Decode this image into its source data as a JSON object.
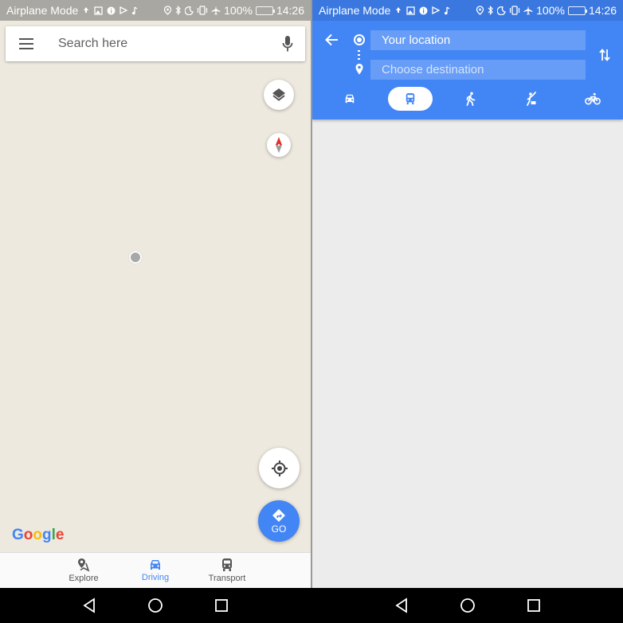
{
  "status_bar_left": {
    "mode_text": "Airplane Mode",
    "battery": "100%",
    "time": "14:26"
  },
  "status_bar_right": {
    "mode_text": "Airplane Mode",
    "battery": "100%",
    "time": "14:26"
  },
  "map": {
    "search_placeholder": "Search here",
    "go_label": "GO",
    "logo": "Google",
    "logo_colors": [
      "#4285f4",
      "#ea4335",
      "#fbbc05",
      "#4285f4",
      "#34a853",
      "#ea4335"
    ],
    "icons": [
      "menu-icon",
      "mic-icon",
      "layers-icon",
      "compass-icon",
      "my-location-icon",
      "directions-icon"
    ]
  },
  "bottom_nav": {
    "items": [
      {
        "label": "Explore",
        "icon": "explore-icon",
        "active": false
      },
      {
        "label": "Driving",
        "icon": "car-icon",
        "active": true
      },
      {
        "label": "Transport",
        "icon": "bus-icon",
        "active": false
      }
    ]
  },
  "directions": {
    "origin": "Your location",
    "destination_placeholder": "Choose destination",
    "modes": [
      {
        "icon": "car-icon",
        "active": false
      },
      {
        "icon": "transit-icon",
        "active": true
      },
      {
        "icon": "walk-icon",
        "active": false
      },
      {
        "icon": "ride-hailing-icon",
        "active": false
      },
      {
        "icon": "bicycle-icon",
        "active": false
      }
    ]
  },
  "colors": {
    "accent": "#4285f4",
    "map_background": "#ede9df",
    "panel_background": "#ececec"
  }
}
